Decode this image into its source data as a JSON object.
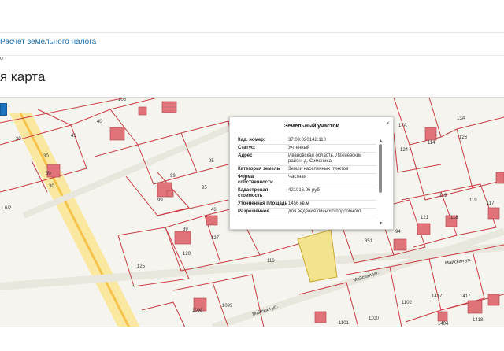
{
  "breadcrumb": {
    "link_text": "Расчет земельного налога",
    "small_text": "о"
  },
  "page": {
    "title": "я карта"
  },
  "map": {
    "street_labels": [
      "Майская ул.",
      "Майская ул.",
      "Майская ул."
    ],
    "parcel_numbers": [
      "106",
      "40",
      "30",
      "41",
      "30",
      "30",
      "99",
      "95",
      "95",
      "99",
      "46",
      "89",
      "120",
      "127",
      "125",
      "116",
      "351",
      "124",
      "17А",
      "13А",
      "114",
      "123",
      "119",
      "119",
      "121",
      "118",
      "117",
      "94",
      "1099",
      "1098",
      "1102",
      "1417",
      "1417",
      "1100",
      "1101",
      "1404",
      "1418",
      "6/2",
      "30"
    ],
    "colors": {
      "road": "#f5c24a",
      "boundary": "#c73d44",
      "building": "#e0737a",
      "highlight": "#f3e38e"
    }
  },
  "popup": {
    "title": "Земельный участок",
    "close_glyph": "×",
    "rows": [
      {
        "key": "Кад. номер:",
        "value": "37:09:020142:110"
      },
      {
        "key": "Статус:",
        "value": "Учтенный"
      },
      {
        "key": "Адрес",
        "value": "Ивановская область, Лежневский район, д. Симониха"
      },
      {
        "key": "Категория земель",
        "value": "Земли населенных пунктов"
      },
      {
        "key": "Форма собственности",
        "value": "Частная"
      },
      {
        "key": "Кадастровая стоимость",
        "value": "421016.96 руб"
      },
      {
        "key": "Уточненная площадь",
        "value": "1456 кв.м"
      },
      {
        "key": "Разрешенное",
        "value": "для ведения личного подсобного"
      }
    ]
  }
}
